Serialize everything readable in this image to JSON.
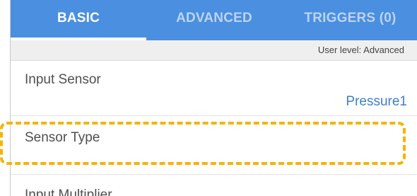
{
  "tabs": [
    {
      "label": "BASIC",
      "active": true
    },
    {
      "label": "ADVANCED",
      "active": false
    },
    {
      "label": "TRIGGERS (0)",
      "active": false
    }
  ],
  "user_level": "User level: Advanced",
  "settings": {
    "input_sensor": {
      "label": "Input Sensor",
      "value": "Pressure1"
    },
    "sensor_type": {
      "label": "Sensor Type"
    },
    "input_multiplier": {
      "label": "Input Multiplier"
    }
  },
  "colors": {
    "tab_bar": "#4a8fe0",
    "active_tab_text": "#ffffff",
    "inactive_tab_text": "#bcd3f2",
    "value_text": "#3f7fc8",
    "highlight": "#f4b400"
  }
}
